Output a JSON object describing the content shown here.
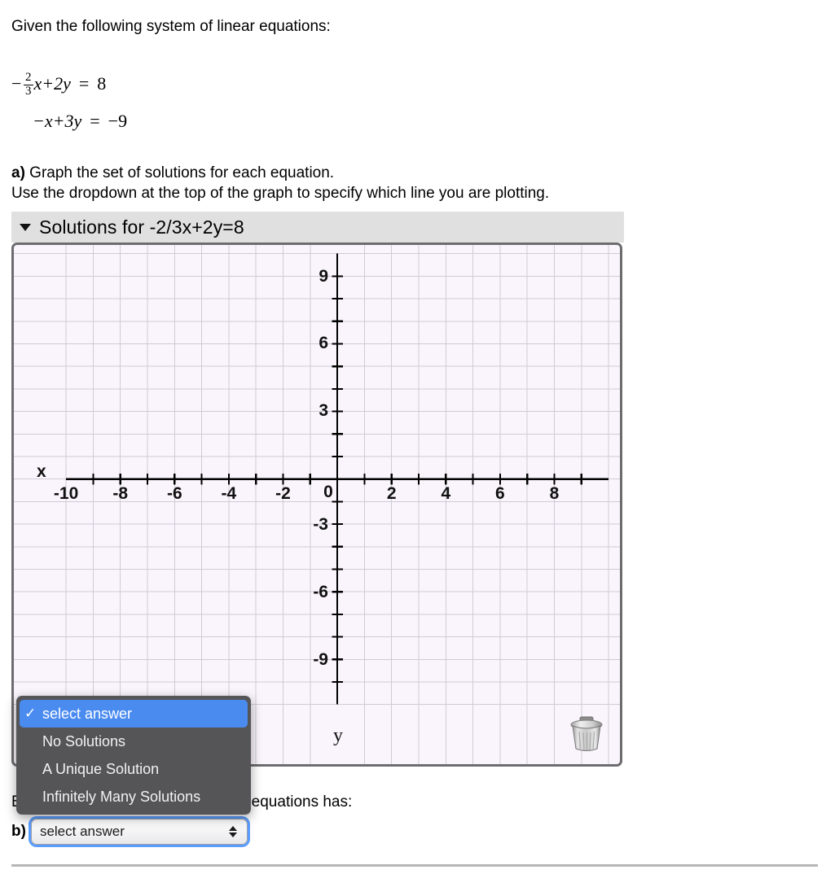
{
  "intro": {
    "text": "Given the following system of linear equations:"
  },
  "equations": [
    {
      "lead": "−",
      "numerator": "2",
      "denominator": "3",
      "after_fraction": "x+2y",
      "equals": "=",
      "rhs": "8"
    },
    {
      "lead": "",
      "lhs": "−x+3y",
      "equals": "=",
      "rhs": "−9"
    }
  ],
  "part_a": {
    "marker": "a)",
    "line1": " Graph the set of solutions for each equation.",
    "line2": "Use the dropdown at the top of the graph to specify which line you are plotting."
  },
  "graph": {
    "header_title": "Solutions for -2/3x+2y=8",
    "caret_icon": "chevron-down-icon",
    "trash_icon": "trash-can-icon",
    "x_axis_label": "x",
    "y_axis_label": "y"
  },
  "chart_data": {
    "type": "scatter",
    "title": "Solutions for -2/3x+2y=8",
    "xlabel": "x",
    "ylabel": "y",
    "xlim": [
      -11.2,
      10.2
    ],
    "ylim": [
      -10.5,
      10.5
    ],
    "x_major_ticks": [
      -10,
      -8,
      -6,
      -4,
      -2,
      0,
      2,
      4,
      6,
      8
    ],
    "x_tick_labels": [
      "-10",
      "-8",
      "-6",
      "-4",
      "-2",
      "0",
      "2",
      "4",
      "6",
      "8"
    ],
    "y_major_ticks": [
      9,
      6,
      3,
      -3,
      -6,
      -9
    ],
    "y_tick_labels": [
      "9",
      "6",
      "3",
      "-3",
      "-6",
      "-9"
    ],
    "x_minor_tick_step": 1,
    "y_minor_tick_step": 1,
    "grid": true,
    "grid_step": 1,
    "legend": "none",
    "series": [],
    "plotted_points": [],
    "note": "Empty coordinate grid; no line has been plotted yet."
  },
  "popup_menu": {
    "check_icon": "check-icon",
    "items": [
      {
        "label": "select answer",
        "selected": true
      },
      {
        "label": "No Solutions",
        "selected": false
      },
      {
        "label": "A Unique Solution",
        "selected": false
      },
      {
        "label": "Infinitely Many Solutions",
        "selected": false
      }
    ]
  },
  "part_b": {
    "question": "Based on the graph, the system of equations has:",
    "marker": "b)",
    "select_value": "select answer",
    "stepper_icon": "up-down-arrows-icon"
  }
}
